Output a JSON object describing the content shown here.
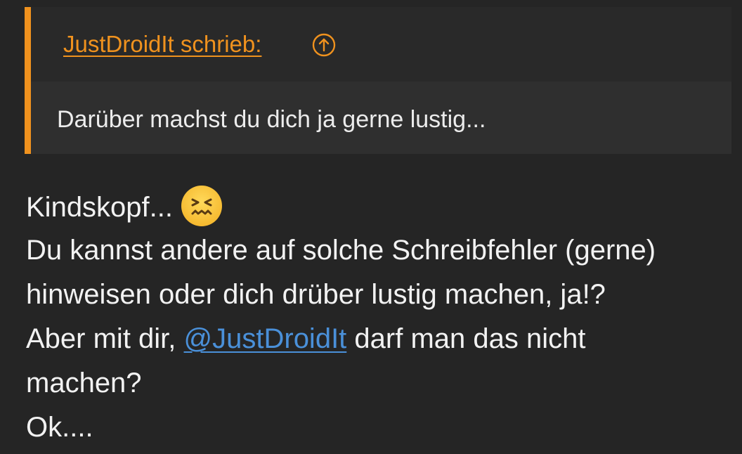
{
  "quote": {
    "author_label": "JustDroidIt schrieb:",
    "jump_icon": "arrow-up-circle-icon",
    "text": "Darüber machst du dich ja gerne lustig..."
  },
  "post": {
    "line1_text": "Kindskopf...",
    "line1_emoji": "confounded-face-icon",
    "line2": "Du kannst andere auf solche Schreibfehler (gerne)",
    "line3": "hinweisen oder dich drüber lustig machen, ja!?",
    "line4_before": "Aber mit dir, ",
    "line4_mention": "@JustDroidIt",
    "line4_after": " darf man das nicht",
    "line5": "machen?",
    "line6": "Ok...."
  },
  "colors": {
    "background": "#252525",
    "quote_background": "#2f2f2f",
    "quote_header_background": "#292929",
    "accent": "#f0921e",
    "mention": "#4a90d9",
    "text": "#f2f2f2"
  }
}
